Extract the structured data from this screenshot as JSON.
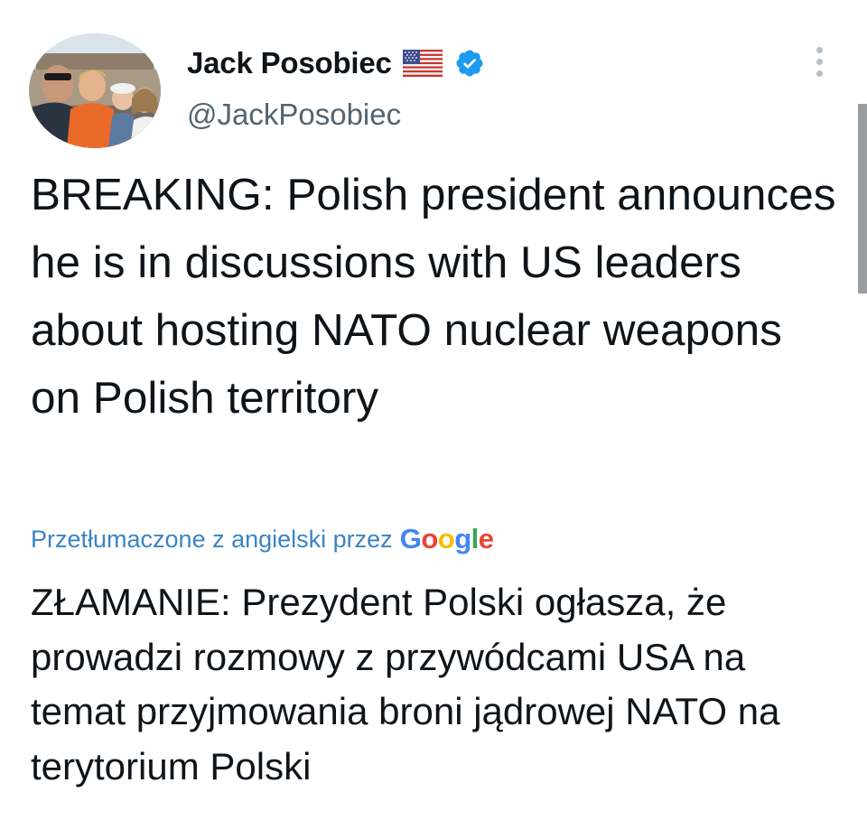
{
  "author": {
    "display_name": "Jack Posobiec",
    "handle": "@JackPosobiec",
    "flag_icon": "us-flag-icon",
    "verified_icon": "verified-badge-icon",
    "verified_color": "#1d9bf0"
  },
  "tweet": {
    "text": "BREAKING: Polish president announces he is in discussions with US leaders about hosting NATO nuclear weapons on Polish territory"
  },
  "translation": {
    "label": "Przetłumaczone z angielski przez",
    "provider": "Google",
    "provider_colors": [
      "#4285f4",
      "#ea4335",
      "#fbbc05",
      "#4285f4",
      "#34a853",
      "#ea4335"
    ],
    "text": "ZŁAMANIE: Prezydent Polski ogłasza, że prowadzi rozmowy z przywódcami USA na temat przyjmowania broni jądrowej NATO na terytorium Polski"
  },
  "colors": {
    "text": "#0f1419",
    "secondary": "#536471",
    "link": "#3a84c4"
  }
}
